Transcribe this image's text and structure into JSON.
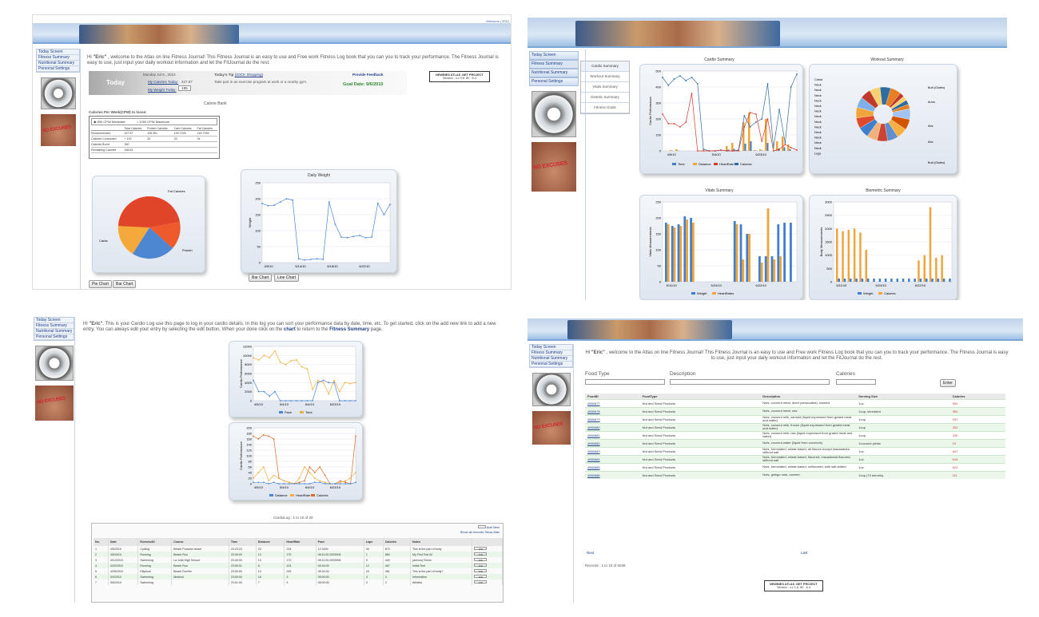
{
  "nav": [
    "Today Screen",
    "Fitness Summary",
    "Nutritional Summary",
    "Personal Settings"
  ],
  "belly_text": "NO EXCUSES",
  "p1": {
    "corner_link": "Welcome | 2012",
    "welcome_hi": "Hi ",
    "user": "\"Eric\"",
    "welcome": " , welcome to the Atlas on line Fitness Journal! This Fitness Journal is an easy to use and Free work Fitness Log book that you can you to track your performance. The Fitness Journal is easy to use, just input your daily workout information and let the FitJournal do the rest.",
    "today": "Today",
    "date": "Monday Jul 5 , 2010",
    "calories_today_label": "My Calories Today:",
    "calories_today": "427.87",
    "weight_today_label": "My Weight Today:",
    "weight_today": "185",
    "tip_label": "Today's Tip",
    "tip_link": "(JOCK Shopping)",
    "tip": "Take part in an exercise program at work or a nearby gym.",
    "feedback": "Provide Feedback",
    "goal": "Goal Date: 9/6/2010",
    "project_box": "NEWBIES ATLAS .NET PROJECT",
    "version": "Version - v.v 0.6, 80 - 6.4",
    "calorie_bank": "Calorie Bank",
    "cpw": "Calories Per Week(CPW) to loose:",
    "radio1": "500 CPW Moderate",
    "radio2": "1000 CPW Maximum",
    "cal_cols": [
      "",
      "Total Calories",
      "Protein Calories",
      "Carb Calories",
      "Fat Calories"
    ],
    "cal_rows": [
      [
        "Recommended",
        "427.87",
        "128.361",
        "149.7245",
        "149.7245"
      ],
      [
        "Calories Consumed",
        "+ 100",
        "33",
        "33",
        "34"
      ],
      [
        "Calories Burnt",
        "350",
        "",
        "",
        ""
      ],
      [
        "Remaining Calories",
        "166.81",
        "",
        "",
        ""
      ]
    ],
    "pie_labels": [
      "Fat Calories",
      "Carbs",
      "Protein"
    ],
    "daily_weight": "Daily Weight",
    "weight_ylabel": "Weight",
    "weight_yticks": [
      "250",
      "200",
      "150",
      "100",
      "50",
      "0"
    ],
    "weight_xticks": [
      "4/5/10",
      "5/14/10",
      "6/18/10",
      "6/22/10"
    ],
    "buttons": [
      "Pie Chart",
      "Bar Chart",
      "Bar Chart",
      "Line Chart"
    ]
  },
  "p2": {
    "tabs": [
      "Today Screen",
      "Fitness Summary",
      "Nutritional Summary",
      "Personal Settings"
    ],
    "submenu": [
      "Cardio Summary",
      "Workout Summary",
      "Vitals Summary",
      "Dietetic Summary",
      "Fitness Goals"
    ],
    "cardio_title": "Cardio Summary",
    "cardio_ylabel": "Cardio Performance",
    "cardio_yticks": [
      "500",
      "400",
      "300",
      "200",
      "100",
      "0"
    ],
    "cardio_xticks": [
      "4/5/10",
      "5/4/10",
      "6/23/10"
    ],
    "cardio_legend": [
      "Time",
      "Distance",
      "HeartRate",
      "Calories"
    ],
    "workout_title": "Workout Summary",
    "workout_left": [
      "Chest",
      "Neck",
      "Neck",
      "Neck",
      "Neck",
      "Neck",
      "Neck",
      "Neck",
      "Neck",
      "Neck",
      "Neck",
      "Neck",
      "Neck",
      "Neck",
      "Legs"
    ],
    "workout_right": [
      "Butt (Glutes)",
      "Arms",
      "Abs",
      "Abs",
      "Butt (Glutes)"
    ],
    "vitals_title": "Vitals Summary",
    "vitals_ylabel": "Vitals Measurements",
    "vitals_yticks": [
      "250",
      "200",
      "150",
      "100",
      "50",
      "0"
    ],
    "vitals_xticks": [
      "5/11/10",
      "5/24/10",
      "6/22/10"
    ],
    "vitals_legend": [
      "Weight",
      "HeartRates"
    ],
    "bio_title": "Biometric Summary",
    "bio_ylabel": "Body Measurements",
    "bio_yticks": [
      "3000",
      "2500",
      "2000",
      "1500",
      "1000",
      "500",
      "0"
    ],
    "bio_xticks": [
      "5/11/10",
      "5/24/10",
      "6/22/10"
    ],
    "bio_legend": [
      "Weight",
      "Calories"
    ]
  },
  "p3": {
    "hi": "Hi ",
    "user": "\"Eric\"",
    "intro": ". This is your Cardio Log use this page to log in your cardio details. In this log you can sort your performance data by date, time, etc. To get started, click on the add new link to add a new entry. You can always edit your entry by selecting the edit button. When your done click on the ",
    "chart_word": "chart",
    "intro2": " to return to the ",
    "fs": "Fitness Summary",
    "intro3": " page.",
    "c1_yticks": [
      "12000",
      "10000",
      "8000",
      "6000",
      "4000",
      "2000",
      "0"
    ],
    "c1_xticks": [
      "4/5/10",
      "5/4/10",
      "6/4/10",
      "6/23/10"
    ],
    "c1_ylabel": "Cardio Performance",
    "c1_legend": [
      "Pace",
      "Time"
    ],
    "c2_yticks": [
      "200",
      "180",
      "160",
      "140",
      "120",
      "100",
      "80",
      "60",
      "40",
      "20",
      "0"
    ],
    "c2_xticks": [
      "4/5/10",
      "5/4/10",
      "6/4/10",
      "6/23/10"
    ],
    "c2_ylabel": "Cardio Performance",
    "c2_legend": [
      "Distance",
      "HeartRate",
      "Calories"
    ],
    "caption": "CardioLog : 1 to 10 of 20",
    "add_new": "Add New",
    "show": "Show all records  Show Max",
    "cols": [
      "No.",
      "Date",
      "ExerciseID",
      "Course",
      "Time",
      "Distance",
      "HeartRate",
      "Pace",
      "Laps",
      "Calories",
      "Notes",
      ""
    ],
    "rows": [
      [
        "1",
        "4/5/2010",
        "Cycling",
        "Beach Porsche beach",
        "24:23:23",
        "23",
        "234",
        "12.3490",
        "34",
        "870",
        "This is the part of body"
      ],
      [
        "2",
        "4/6/2010",
        "Running",
        "Beach Run",
        "23:30:00",
        "13",
        "170",
        "08:11:00.2003908",
        "1",
        "860",
        "My First Test #2"
      ],
      [
        "3",
        "4/12/2010",
        "Swimming",
        "La Jolla High School",
        "23:40:00",
        "14",
        "170",
        "08:11:00.2003908",
        "5",
        "440",
        "(amnus) Room"
      ],
      [
        "4",
        "4/20/2010",
        "Running",
        "Beach Run",
        "23:50:01",
        "8",
        "103",
        "08:34:00",
        "12",
        "467",
        "Initial Test"
      ],
      [
        "5",
        "4/26/2010",
        "Elliptical",
        "Beach Run/fm",
        "23:50:50",
        "13",
        "245",
        "08:34:00",
        "24",
        "461",
        "This is the part of body?"
      ],
      [
        "6",
        "5/4/2010",
        "Swimming",
        "Medical",
        "23:50:00",
        "18",
        "3",
        "08:00:00",
        "3",
        "3",
        "Information"
      ],
      [
        "7",
        "5/6/2010",
        "Swimming",
        "",
        "23:51:00",
        "7",
        "9",
        "08:00:00",
        "3",
        "3",
        "Wristba"
      ]
    ],
    "edit": "Edit"
  },
  "p4": {
    "hi": "Hi ",
    "user": "\"Eric\"",
    "welcome": " , welcome to the Atlas on line Fitness Journal! This Fitness Journal is an easy to use and Free work Fitness Log book that you can you to track your performance. The Fitness Journal is easy to use, just input your daily workout information and let the FitJournal do the rest.",
    "f_type": "Food Type",
    "f_desc": "Description",
    "f_cal": "Calories",
    "enter": "Enter",
    "cols": [
      "FoodID",
      "FoodType",
      "Description",
      "Serving Size",
      "Calories"
    ],
    "rows": [
      [
        "4560677",
        "Nut and Seed Products",
        "Nuts, coconut meat, dried (desiccated), toasted",
        "1oz",
        "592"
      ],
      [
        "4560678",
        "Nut and Seed Products",
        "Nuts, coconut meat, raw",
        "1cup, shredded",
        "354"
      ],
      [
        "4560679",
        "Nut and Seed Products",
        "Nuts, coconut milk, canned (liquid expressed from grated meat and water)",
        "1cup",
        "197"
      ],
      [
        "4560680",
        "Nut and Seed Products",
        "Nuts, coconut milk, frozen (liquid expressed from grated meat and water)",
        "1cup",
        "202"
      ],
      [
        "4560681",
        "Nut and Seed Products",
        "Nuts, coconut milk, raw (liquid expressed from grated meat and water)",
        "1cup",
        "230"
      ],
      [
        "4560682",
        "Nut and Seed Products",
        "Nuts, coconut water (liquid from coconuts)",
        "1coconut yields",
        "19"
      ],
      [
        "4560683",
        "Nut and Seed Products",
        "Nuts, formulated, wheat-based, all flavors except macadamia, without salt",
        "1oz",
        "647"
      ],
      [
        "4560684",
        "Nut and Seed Products",
        "Nuts, formulated, wheat-based, flavored, macadamia flavored, without salt",
        "1oz",
        "619"
      ],
      [
        "4560685",
        "Nut and Seed Products",
        "Nuts, formulated, wheat-based, unflavored, with salt added",
        "1oz",
        "622"
      ],
      [
        "4560686",
        "Nut and Seed Products",
        "Nuts, ginkgo nuts, canned",
        "1cup (70 kernels)",
        "111"
      ]
    ],
    "next": "Next",
    "last": "Last",
    "records": "Records : 1 to 10 of 6038",
    "project_box": "NEWBIES ATLAS .NET PROJECT",
    "version": "Version - v.v 1.6, 80 - 6.4"
  }
}
